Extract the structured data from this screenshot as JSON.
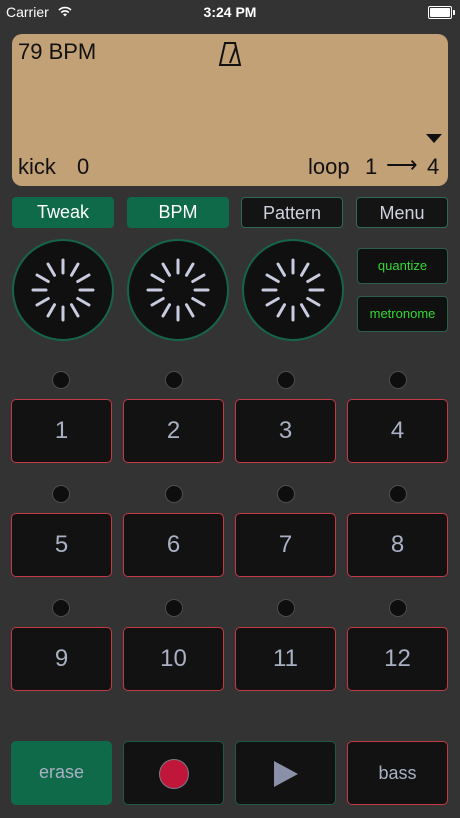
{
  "status_bar": {
    "carrier": "Carrier",
    "time": "3:24 PM"
  },
  "display": {
    "bpm": "79 BPM",
    "instrument": "kick",
    "instrument_value": "0",
    "loop_label": "loop",
    "loop_from": "1",
    "loop_arrow": "⟶",
    "loop_to": "4"
  },
  "top_buttons": {
    "tweak": "Tweak",
    "bpm": "BPM",
    "pattern": "Pattern",
    "menu": "Menu"
  },
  "side_buttons": {
    "quantize": "quantize",
    "metronome": "metronome"
  },
  "pads": [
    "1",
    "2",
    "3",
    "4",
    "5",
    "6",
    "7",
    "8",
    "9",
    "10",
    "11",
    "12"
  ],
  "bottom": {
    "erase": "erase",
    "bass": "bass"
  },
  "colors": {
    "background": "#333333",
    "display": "#c3a176",
    "accent_green": "#0f6a4a",
    "pad_border": "#c23a44",
    "record_red": "#c0163a",
    "side_text": "#33d833"
  }
}
